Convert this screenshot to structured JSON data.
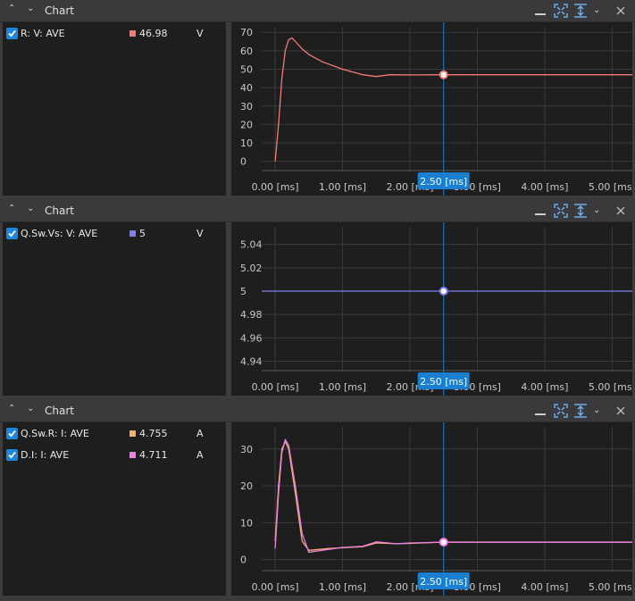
{
  "colors": {
    "r_v": "#f47a78",
    "vs_v": "#8080f0",
    "sw_r_i": "#f0b070",
    "d_i": "#f080e0",
    "accent": "#1c86e0",
    "cursor_label": "#1a7fd1"
  },
  "icons": [
    "chevron-up-icon",
    "chevron-down-icon",
    "minimize-icon",
    "fit-all-icon",
    "fit-vertical-icon",
    "dropdown-icon",
    "close-icon",
    "checkbox-checked-icon"
  ],
  "x_axis": {
    "unit": "ms",
    "range": [
      -0.2,
      5.3
    ],
    "ticks": [
      "0.00 [ms]",
      "1.00 [ms]",
      "2.00 [ms]",
      "3.00 [ms]",
      "4.00 [ms]",
      "5.00 [ms]"
    ],
    "cursor_value": 2.5,
    "cursor_label": "2.50 [ms]"
  },
  "panels": [
    {
      "title": "Chart",
      "legend": [
        {
          "name": "R: V: AVE",
          "value": "46.98",
          "unit": "V",
          "color": "#f47a78"
        }
      ],
      "chart_data": {
        "type": "line",
        "ylim": [
          -5,
          73
        ],
        "y_ticks": [
          "70",
          "60",
          "50",
          "40",
          "30",
          "20",
          "10",
          "0"
        ],
        "series": [
          {
            "name": "R: V: AVE",
            "color": "#f47a78",
            "x": [
              0.0,
              0.05,
              0.1,
              0.15,
              0.2,
              0.25,
              0.3,
              0.4,
              0.5,
              0.7,
              1.0,
              1.3,
              1.5,
              1.7,
              2.0,
              2.5,
              3.0,
              4.0,
              5.3
            ],
            "values": [
              0,
              20,
              45,
              60,
              66,
              67,
              65,
              61,
              58,
              54,
              50,
              47,
              46,
              47,
              46.9,
              46.98,
              46.98,
              46.98,
              46.98
            ]
          }
        ],
        "cursor_point": {
          "x": 2.5,
          "y": 46.98
        }
      }
    },
    {
      "title": "Chart",
      "legend": [
        {
          "name": "Q.Sw.Vs: V: AVE",
          "value": "5",
          "unit": "V",
          "color": "#8080f0"
        }
      ],
      "chart_data": {
        "type": "line",
        "ylim": [
          4.932,
          5.055
        ],
        "y_ticks": [
          "5.04",
          "5.02",
          "5",
          "4.98",
          "4.96",
          "4.94"
        ],
        "series": [
          {
            "name": "Q.Sw.Vs: V: AVE",
            "color": "#8080f0",
            "x": [
              -0.2,
              5.3
            ],
            "values": [
              5,
              5
            ]
          }
        ],
        "cursor_point": {
          "x": 2.5,
          "y": 5
        }
      }
    },
    {
      "title": "Chart",
      "legend": [
        {
          "name": "Q.Sw.R: I: AVE",
          "value": "4.755",
          "unit": "A",
          "color": "#f0b070"
        },
        {
          "name": "D.I: I: AVE",
          "value": "4.711",
          "unit": "A",
          "color": "#f080e0"
        }
      ],
      "chart_data": {
        "type": "line",
        "ylim": [
          -3,
          36
        ],
        "y_ticks": [
          "30",
          "20",
          "10",
          "0"
        ],
        "series": [
          {
            "name": "Q.Sw.R: I: AVE",
            "color": "#f0b070",
            "x": [
              0.0,
              0.05,
              0.1,
              0.15,
              0.2,
              0.3,
              0.4,
              0.5,
              0.8,
              1.0,
              1.3,
              1.5,
              1.8,
              2.0,
              2.5,
              3.0,
              4.0,
              5.3
            ],
            "values": [
              5,
              20,
              30,
              32,
              30,
              18,
              5,
              2.5,
              3,
              3.2,
              3.5,
              4.5,
              4.3,
              4.4,
              4.755,
              4.755,
              4.755,
              4.755
            ]
          },
          {
            "name": "D.I: I: AVE",
            "color": "#f080e0",
            "x": [
              0.0,
              0.05,
              0.1,
              0.15,
              0.2,
              0.3,
              0.4,
              0.5,
              0.8,
              1.0,
              1.3,
              1.5,
              1.8,
              2.0,
              2.5,
              3.0,
              4.0,
              5.3
            ],
            "values": [
              3,
              18,
              29,
              32.5,
              31,
              20,
              7,
              2,
              2.8,
              3.3,
              3.6,
              4.8,
              4.3,
              4.5,
              4.711,
              4.711,
              4.711,
              4.711
            ]
          }
        ],
        "cursor_point": {
          "x": 2.5,
          "y": 4.73
        }
      }
    }
  ]
}
